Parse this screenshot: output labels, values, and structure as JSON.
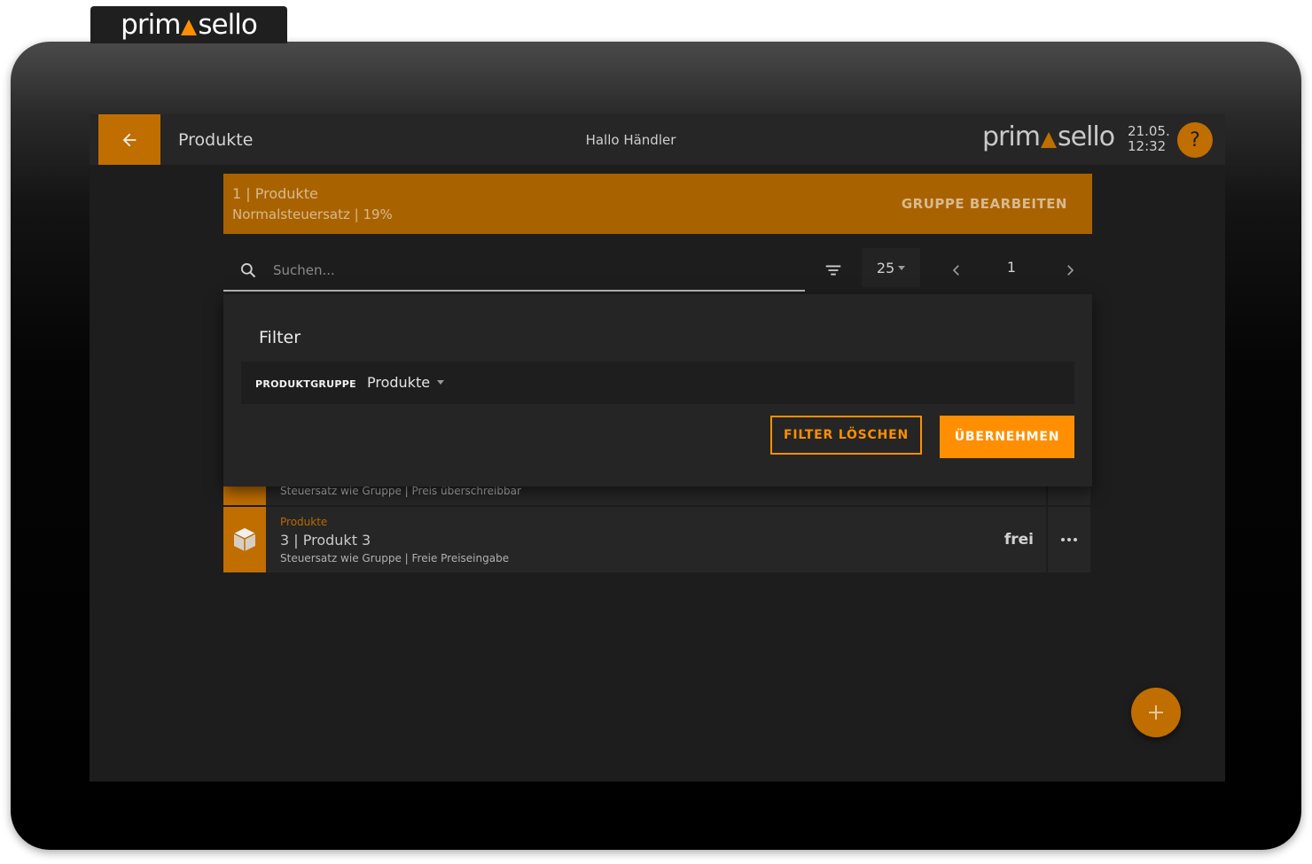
{
  "brand": {
    "logo_left": "prim",
    "logo_right": "sello",
    "accent": "#ff8f00",
    "accent_dark": "#c06e00"
  },
  "topbar": {
    "back_icon": "arrow-left-icon",
    "title": "Produkte",
    "greeting": "Hallo Händler",
    "date": "21.05.",
    "time": "12:32",
    "help_label": "?"
  },
  "group": {
    "title": "1 | Produkte",
    "subtitle": "Normalsteuersatz | 19%",
    "edit_label": "GRUPPE BEARBEITEN"
  },
  "search": {
    "placeholder": "Suchen...",
    "value": ""
  },
  "list_controls": {
    "filter_icon": "filter-icon",
    "page_size": "25",
    "page_number": "1"
  },
  "filter": {
    "heading": "Filter",
    "field_label": "PRODUKTGRUPPE",
    "field_value": "Produkte",
    "clear_label": "FILTER LÖSCHEN",
    "apply_label": "ÜBERNEHMEN"
  },
  "products": [
    {
      "group": "",
      "title": "",
      "subtitle": "Steuersatz wie Gruppe | Preis überschreibbar",
      "price": ""
    },
    {
      "group": "Produkte",
      "title": "3 | Produkt 3",
      "subtitle": "Steuersatz wie Gruppe | Freie Preiseingabe",
      "price": "frei"
    }
  ],
  "fab_icon": "plus-icon"
}
